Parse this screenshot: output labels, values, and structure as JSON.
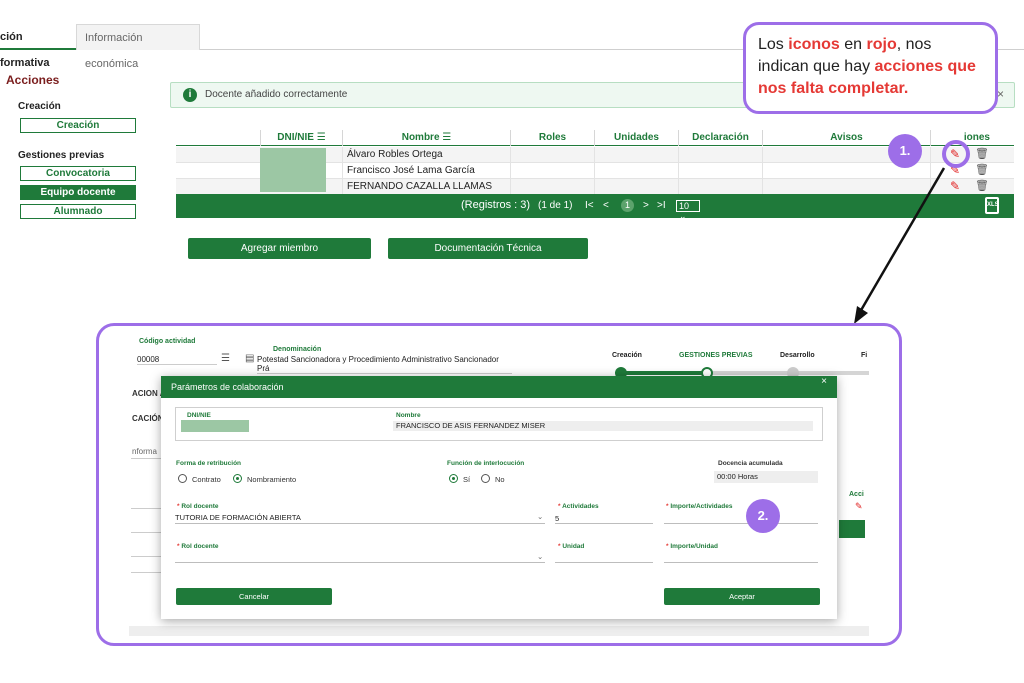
{
  "tabs": {
    "active": "ción formativa",
    "inactive": "Información económica"
  },
  "sidebar": {
    "title": "Acciones",
    "section_creacion": "Creación",
    "btn_creacion": "Creación",
    "section_gestiones": "Gestiones previas",
    "btn_convocatoria": "Convocatoria",
    "btn_equipo": "Equipo docente",
    "btn_alumnado": "Alumnado"
  },
  "alert": {
    "icon": "i",
    "text": "Docente añadido correctamente",
    "close": "×"
  },
  "table": {
    "headers": [
      "DNI/NIE",
      "Nombre",
      "Roles",
      "Unidades",
      "Declaración",
      "Avisos",
      "Acciones"
    ],
    "header_partial_acciones": "iones",
    "sort_icon": "☰",
    "rows": [
      {
        "nombre": "Álvaro Robles Ortega"
      },
      {
        "nombre": "Francisco José Lama García"
      },
      {
        "nombre": "FERNANDO CAZALLA LLAMAS"
      }
    ]
  },
  "pager": {
    "registros": "(Registros : 3)",
    "pagina": "(1 de 1)",
    "first": "I<",
    "prev": "<",
    "current": "1",
    "next": ">",
    "last": ">I",
    "page_size": "10",
    "export": "XLS"
  },
  "buttons": {
    "agregar": "Agregar miembro",
    "documentacion": "Documentación Técnica"
  },
  "callout": {
    "t1": "Los ",
    "t2": "iconos",
    "t3": " en ",
    "t4": "rojo",
    "t5": ", nos indican que hay ",
    "t6": "acciones que nos falta completar."
  },
  "badges": {
    "b1": "1.",
    "b2": "2."
  },
  "screen2": {
    "codigo_label": "Código actividad",
    "codigo_value": "00008",
    "denominacion_label": "Denominación",
    "denominacion_value": "Potestad Sancionadora y Procedimiento Administrativo Sancionador Prá",
    "stages": [
      "Creación",
      "GESTIONES PREVIAS",
      "Desarrollo",
      "Fi"
    ],
    "left_cut_1": "ACION A",
    "left_cut_2": "CACIÓN I",
    "left_cut_3": "nforma",
    "right_cut": "Acci"
  },
  "modal": {
    "title": "Parámetros de colaboración",
    "close": "×",
    "dni_label": "DNI/NIE",
    "nombre_label": "Nombre",
    "nombre_value": "FRANCISCO DE ASIS FERNANDEZ MISER",
    "forma_label": "Forma de retribución",
    "opt_contrato": "Contrato",
    "opt_nombramiento": "Nombramiento",
    "funcion_label": "Función de interlocución",
    "opt_si": "Sí",
    "opt_no": "No",
    "docencia_label": "Docencia acumulada",
    "docencia_value": "00:00 Horas",
    "rol1_label": "Rol docente",
    "rol1_value": "TUTORIA DE FORMACIÓN ABIERTA",
    "actividades_label": "Actividades",
    "actividades_value": "5",
    "importe_act_label": "Importe/Actividades",
    "rol2_label": "Rol docente",
    "unidad_label": "Unidad",
    "importe_uni_label": "Importe/Unidad",
    "required_mark": "*",
    "cancel": "Cancelar",
    "accept": "Aceptar"
  },
  "colors": {
    "primary": "#1f7a3a",
    "accent": "#9d6ee8",
    "alert": "#e53935"
  }
}
